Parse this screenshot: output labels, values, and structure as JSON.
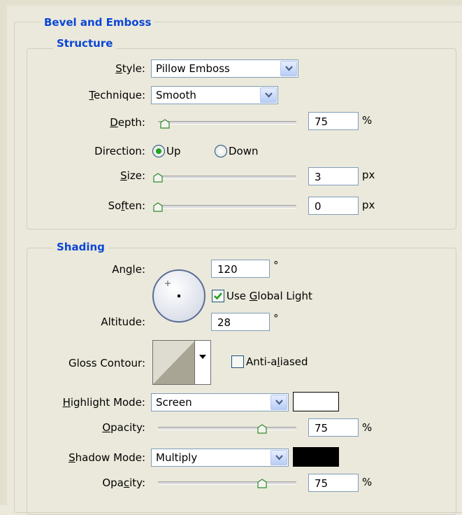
{
  "panel": {
    "title": "Bevel and Emboss"
  },
  "structure": {
    "title": "Structure",
    "style": {
      "label_pre": "",
      "label_u": "S",
      "label_post": "tyle:",
      "value": "Pillow Emboss"
    },
    "technique": {
      "label_pre": "",
      "label_u": "T",
      "label_post": "echnique:",
      "value": "Smooth"
    },
    "depth": {
      "label_pre": "",
      "label_u": "D",
      "label_post": "epth:",
      "value": "75",
      "unit": "%",
      "slider_fraction": 0.05
    },
    "direction": {
      "label": "Direction:",
      "up_label": "Up",
      "down_label": "Down",
      "selected": "Up"
    },
    "size": {
      "label_pre": "",
      "label_u": "S",
      "label_post": "ize:",
      "value": "3",
      "unit": "px",
      "slider_fraction": 0.0
    },
    "soften": {
      "label_pre": "So",
      "label_u": "f",
      "label_post": "ten:",
      "value": "0",
      "unit": "px",
      "slider_fraction": 0.0
    }
  },
  "shading": {
    "title": "Shading",
    "angle": {
      "label_pre": "An",
      "label_u": "g",
      "label_post": "le:",
      "value": "120",
      "unit": "°"
    },
    "global_light": {
      "label_pre": "Use ",
      "label_u": "G",
      "label_post": "lobal Light",
      "checked": true
    },
    "altitude": {
      "label": "Altitude:",
      "value": "28",
      "unit": "°"
    },
    "gloss_contour": {
      "label": "Gloss Contour:"
    },
    "anti_aliased": {
      "label_pre": "Anti-a",
      "label_u": "l",
      "label_post": "iased",
      "checked": false
    },
    "highlight_mode": {
      "label_pre": "",
      "label_u": "H",
      "label_post": "ighlight Mode:",
      "value": "Screen",
      "color": "#ffffff"
    },
    "highlight_opacity": {
      "label_pre": "",
      "label_u": "O",
      "label_post": "pacity:",
      "value": "75",
      "unit": "%",
      "slider_fraction": 0.75
    },
    "shadow_mode": {
      "label_pre": "",
      "label_u": "S",
      "label_post": "hadow Mode:",
      "value": "Multiply",
      "color": "#000000"
    },
    "shadow_opacity": {
      "label_pre": "Opa",
      "label_u": "c",
      "label_post": "ity:",
      "value": "75",
      "unit": "%",
      "slider_fraction": 0.75
    }
  }
}
